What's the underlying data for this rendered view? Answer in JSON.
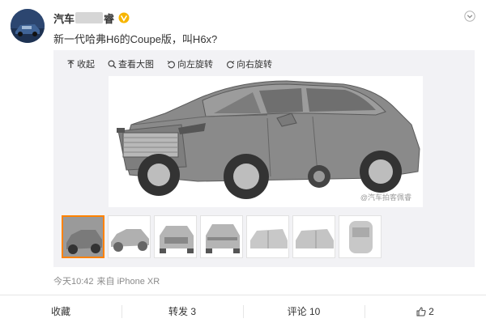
{
  "post": {
    "author_prefix": "汽车",
    "author_suffix": "睿",
    "text": "新一代哈弗H6的Coupe版，叫H6x?",
    "time": "今天10:42",
    "source": "来自 iPhone XR"
  },
  "toolbar": {
    "collapse": "收起",
    "view_large": "查看大图",
    "rotate_left": "向左旋转",
    "rotate_right": "向右旋转"
  },
  "media": {
    "watermark": "@汽车拍客佩睿",
    "thumbnail_count": 7,
    "selected_index": 0
  },
  "actions": {
    "favorite": "收藏",
    "repost": "转发 3",
    "comment": "评论 10",
    "like_count": "2"
  },
  "colors": {
    "accent": "#ff8200",
    "verified": "#f7b500",
    "text": "#333333",
    "muted": "#8a8a8a"
  },
  "icons": [
    "avatar",
    "verified-v-icon",
    "chevron-down-icon",
    "collapse-icon",
    "zoom-icon",
    "rotate-left-icon",
    "rotate-right-icon",
    "thumbs-up-icon"
  ]
}
